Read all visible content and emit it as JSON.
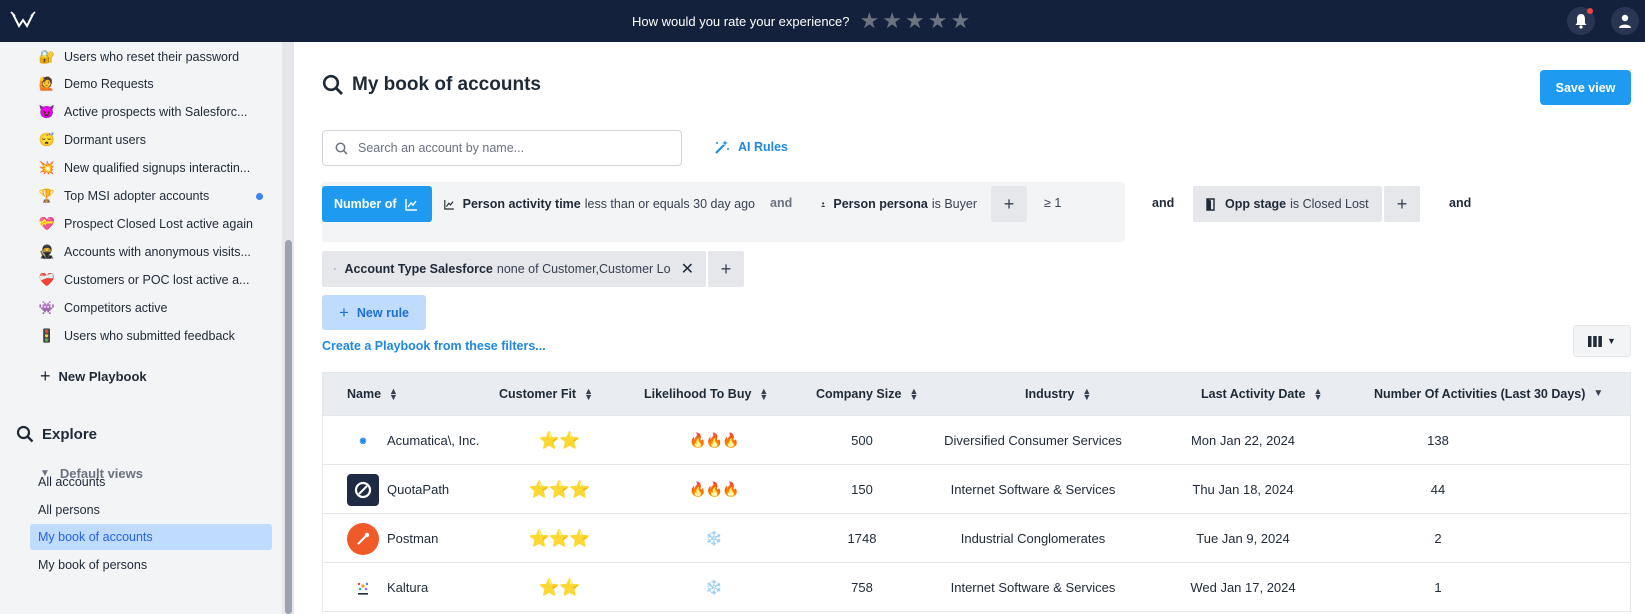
{
  "topbar": {
    "rate_question": "How would you rate your experience?",
    "stars": [
      "★",
      "★",
      "★",
      "★",
      "★"
    ]
  },
  "sidebar": {
    "playbooks": [
      {
        "emoji": "🔐",
        "label": "Users who reset their password"
      },
      {
        "emoji": "🙋",
        "label": "Demo Requests"
      },
      {
        "emoji": "😈",
        "label": "Active prospects with Salesforc..."
      },
      {
        "emoji": "😴",
        "label": "Dormant users"
      },
      {
        "emoji": "💥",
        "label": "New qualified signups interactin..."
      },
      {
        "emoji": "🏆",
        "label": "Top MSI adopter accounts"
      },
      {
        "emoji": "💝",
        "label": "Prospect Closed Lost active again"
      },
      {
        "emoji": "🥷",
        "label": "Accounts with anonymous visits..."
      },
      {
        "emoji": "❤️‍🩹",
        "label": "Customers or POC lost active a..."
      },
      {
        "emoji": "👾",
        "label": "Competitors active"
      },
      {
        "emoji": "🚦",
        "label": "Users who submitted feedback"
      }
    ],
    "new_playbook": "New Playbook",
    "explore": "Explore",
    "default_views": "Default views",
    "views": [
      "All accounts",
      "All persons",
      "My book of accounts",
      "My book of persons"
    ],
    "active_view_index": 2
  },
  "main": {
    "title": "My book of accounts",
    "save_view": "Save view",
    "search_placeholder": "Search an account by name...",
    "ai_rules": "AI Rules",
    "number_of": "Number of",
    "chip1_bold": "Person activity time",
    "chip1_rest": "less than or equals 30 day ago",
    "and": "and",
    "chip2_bold": "Person persona",
    "chip2_rest": "is Buyer",
    "gte": "≥ 1",
    "chip3_bold": "Opp stage",
    "chip3_rest": "is Closed Lost",
    "chip4_bold": "Account Type Salesforce",
    "chip4_rest": "none of Customer,Customer Lo",
    "new_rule": "New rule",
    "create_playbook": "Create a Playbook from these filters..."
  },
  "table": {
    "headers": [
      "Name",
      "Customer Fit",
      "Likelihood To Buy",
      "Company Size",
      "Industry",
      "Last Activity Date",
      "Number Of Activities (Last 30 Days)"
    ],
    "rows": [
      {
        "name": "Acumatica\\, Inc.",
        "fit": "⭐⭐",
        "likelihood": "🔥🔥🔥",
        "size": "500",
        "industry": "Diversified Consumer Services",
        "last_activity": "Mon Jan 22, 2024",
        "activities": "138"
      },
      {
        "name": "QuotaPath",
        "fit": "⭐⭐⭐",
        "likelihood": "🔥🔥🔥",
        "size": "150",
        "industry": "Internet Software & Services",
        "last_activity": "Thu Jan 18, 2024",
        "activities": "44"
      },
      {
        "name": "Postman",
        "fit": "⭐⭐⭐",
        "likelihood": "❄️",
        "size": "1748",
        "industry": "Industrial Conglomerates",
        "last_activity": "Tue Jan 9, 2024",
        "activities": "2"
      },
      {
        "name": "Kaltura",
        "fit": "⭐⭐",
        "likelihood": "❄️",
        "size": "758",
        "industry": "Internet Software & Services",
        "last_activity": "Wed Jan 17, 2024",
        "activities": "1"
      }
    ]
  },
  "colors": {
    "topbar": "#14213d",
    "accent": "#1e9bf0",
    "active_view_bg": "#bfdbfe"
  }
}
